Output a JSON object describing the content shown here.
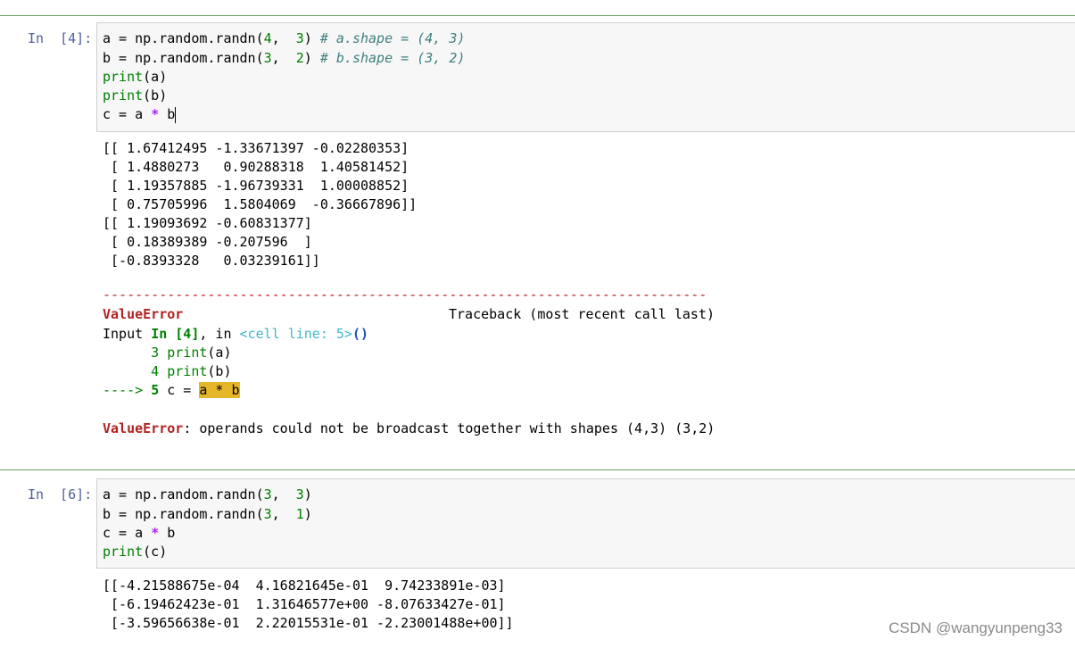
{
  "cell1": {
    "prompt": "In  [4]:",
    "code": {
      "l1_a": "a",
      "l1_eq": " = np.random.randn(",
      "l1_n1": "4",
      "l1_c": ",  ",
      "l1_n2": "3",
      "l1_close": ") ",
      "l1_cmt": "# a.shape = (4, 3)",
      "l2_b": "b",
      "l2_eq": " = np.random.randn(",
      "l2_n1": "3",
      "l2_c": ",  ",
      "l2_n2": "2",
      "l2_close": ") ",
      "l2_cmt": "# b.shape = (3, 2)",
      "l3_print": "print",
      "l3_rest": "(a)",
      "l4_print": "print",
      "l4_rest": "(b)",
      "l5_pre": "c = a ",
      "l5_op": "*",
      "l5_post": " b"
    },
    "output": [
      "[[ 1.67412495 -1.33671397 -0.02280353]",
      " [ 1.4880273   0.90288318  1.40581452]",
      " [ 1.19357885 -1.96739331  1.00008852]",
      " [ 0.75705996  1.5804069  -0.36667896]]",
      "[[ 1.19093692 -0.60831377]",
      " [ 0.18389389 -0.207596  ]",
      " [-0.8393328   0.03239161]]"
    ],
    "traceback": {
      "dashes": "---------------------------------------------------------------------------",
      "error_name": "ValueError",
      "header_right": "Traceback (most recent call last)",
      "input_pre": "Input ",
      "input_in": "In [4]",
      "input_mid": ", in ",
      "cell_line": "<cell line: 5>",
      "input_paren": "()",
      "line3_num": "      3 ",
      "line3_print": "print",
      "line3_rest": "(a)",
      "line4_num": "      4 ",
      "line4_print": "print",
      "line4_rest": "(b)",
      "arrow": "----> ",
      "line5_num": "5",
      "line5_pre": " c = ",
      "line5_hl": "a * b",
      "final_name": "ValueError",
      "final_msg": ": operands could not be broadcast together with shapes (4,3) (3,2)"
    }
  },
  "cell2": {
    "prompt": "In  [6]:",
    "code": {
      "l1_a": "a",
      "l1_eq": " = np.random.randn(",
      "l1_n1": "3",
      "l1_c": ",  ",
      "l1_n2": "3",
      "l1_close": ")",
      "l2_b": "b",
      "l2_eq": " = np.random.randn(",
      "l2_n1": "3",
      "l2_c": ",  ",
      "l2_n2": "1",
      "l2_close": ")",
      "l3_pre": "c = a ",
      "l3_op": "*",
      "l3_post": " b",
      "l4_print": "print",
      "l4_rest": "(c)"
    },
    "output": [
      "[[-4.21588675e-04  4.16821645e-01  9.74233891e-03]",
      " [-6.19462423e-01  1.31646577e+00 -8.07633427e-01]",
      " [-3.59656638e-01  2.22015531e-01 -2.23001488e+00]]"
    ]
  },
  "watermark": "CSDN @wangyunpeng33"
}
